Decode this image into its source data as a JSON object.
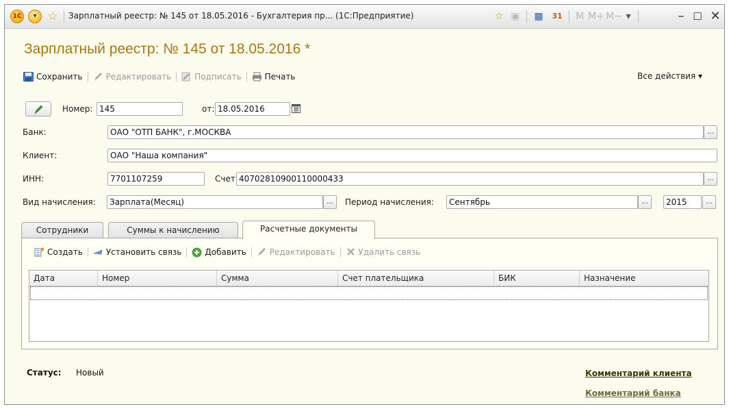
{
  "window": {
    "title": "Зарплатный реестр: № 145 от 18.05.2016 - Бухгалтерия пр...  (1С:Предприятие)",
    "logo_text": "1С",
    "tools": {
      "m": "M",
      "m_plus": "M+",
      "m_minus": "M−"
    }
  },
  "document": {
    "title": "Зарплатный реестр: № 145 от 18.05.2016 *"
  },
  "toolbar": {
    "save": "Сохранить",
    "edit": "Редактировать",
    "sign": "Подписать",
    "print": "Печать",
    "all_actions": "Все действия ▾"
  },
  "form": {
    "number_label": "Номер:",
    "number_value": "145",
    "date_label": "от:",
    "date_value": "18.05.2016",
    "bank_label": "Банк:",
    "bank_value": "ОАО \"ОТП БАНК\", г.МОСКВА",
    "client_label": "Клиент:",
    "client_value": "ОАО \"Наша компания\"",
    "inn_label": "ИНН:",
    "inn_value": "7701107259",
    "account_label": "Счет:",
    "account_value": "40702810900110000433",
    "accrual_type_label": "Вид начисления:",
    "accrual_type_value": "Зарплата(Месяц)",
    "period_label": "Период начисления:",
    "period_month": "Сентябрь",
    "period_year": "2015"
  },
  "tabs": [
    {
      "label": "Сотрудники"
    },
    {
      "label": "Суммы к начислению"
    },
    {
      "label": "Расчетные документы"
    }
  ],
  "subtoolbar": {
    "create": "Создать",
    "link": "Установить связь",
    "add": "Добавить",
    "edit": "Редактировать",
    "unlink": "Удалить связь"
  },
  "table": {
    "columns": [
      "Дата",
      "Номер",
      "Сумма",
      "Счет плательщика",
      "БИК",
      "Назначение"
    ],
    "rows": []
  },
  "status": {
    "label": "Статус:",
    "value": "Новый"
  },
  "links": {
    "client_comment": "Комментарий клиента",
    "bank_comment": "Комментарий банка"
  },
  "colors": {
    "title": "#a77811",
    "link_dark": "#3a3a00",
    "link_muted": "#6f6a3e",
    "background": "#fbfbee"
  }
}
